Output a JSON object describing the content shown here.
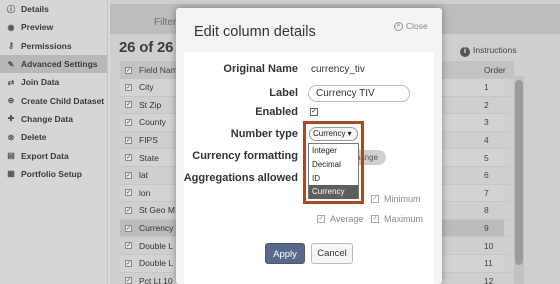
{
  "sidebar": {
    "items": [
      {
        "icon": "info-icon",
        "glyph": "ⓘ",
        "label": "Details",
        "active": false
      },
      {
        "icon": "eye-icon",
        "glyph": "◉",
        "label": "Preview",
        "active": false
      },
      {
        "icon": "key-icon",
        "glyph": "⚷",
        "label": "Permissions",
        "active": false
      },
      {
        "icon": "wrench-icon",
        "glyph": "✎",
        "label": "Advanced Settings",
        "active": true
      },
      {
        "icon": "join-icon",
        "glyph": "⇄",
        "label": "Join Data",
        "active": false
      },
      {
        "icon": "child-dataset-icon",
        "glyph": "⊕",
        "label": "Create Child Dataset",
        "active": false
      },
      {
        "icon": "change-data-icon",
        "glyph": "✚",
        "label": "Change Data",
        "active": false
      },
      {
        "icon": "delete-icon",
        "glyph": "⊗",
        "label": "Delete",
        "active": false
      },
      {
        "icon": "export-icon",
        "glyph": "▤",
        "label": "Export Data",
        "active": false
      },
      {
        "icon": "portfolio-icon",
        "glyph": "▦",
        "label": "Portfolio Setup",
        "active": false
      }
    ]
  },
  "main": {
    "filters_label": "Filters",
    "rows_title": "26 of 26 fi",
    "instructions_label": "Instructions",
    "table": {
      "field_header": "Field Nam",
      "order_header": "Order",
      "rows": [
        {
          "field": "City",
          "order": "1"
        },
        {
          "field": "St Zip",
          "order": "2"
        },
        {
          "field": "County",
          "order": "3"
        },
        {
          "field": "FIPS",
          "order": "4"
        },
        {
          "field": "State",
          "order": "5"
        },
        {
          "field": "lat",
          "order": "6"
        },
        {
          "field": "lon",
          "order": "7"
        },
        {
          "field": "St Geo M",
          "order": "8"
        },
        {
          "field": "Currency",
          "order": "9"
        },
        {
          "field": "Double L",
          "order": "10"
        },
        {
          "field": "Double L",
          "order": "11"
        },
        {
          "field": "Pct Lt 10",
          "order": "12"
        }
      ]
    }
  },
  "modal": {
    "title": "Edit column details",
    "close_label": "Close",
    "original_name_label": "Original Name",
    "original_name_value": "currency_tiv",
    "label_label": "Label",
    "label_value": "Currency TIV",
    "enabled_label": "Enabled",
    "number_type_label": "Number type",
    "number_type_value": "Currency ▾",
    "number_type_options": [
      "Integer",
      "Decimal",
      "ID",
      "Currency"
    ],
    "currency_formatting_label": "Currency formatting",
    "currency_formatting_button": "hange",
    "aggregations_label": "Aggregations allowed",
    "aggregations": {
      "minimum": "Minimum",
      "average": "Average",
      "maximum": "Maximum"
    },
    "apply_label": "Apply",
    "cancel_label": "Cancel"
  },
  "colors": {
    "highlight_border": "#a84a25",
    "apply_button": "#58698c",
    "selected_option": "#5e5e5e"
  }
}
